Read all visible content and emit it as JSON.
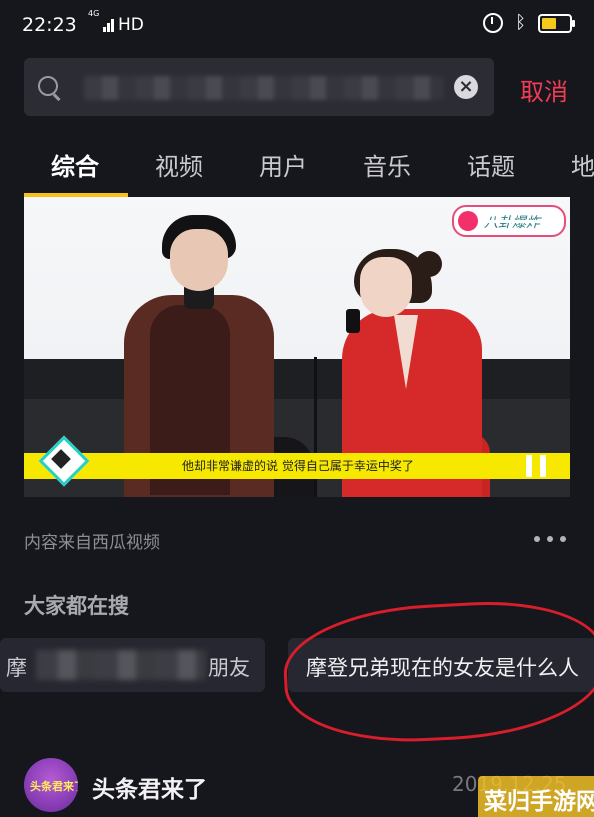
{
  "status_bar": {
    "time": "22:23",
    "network_small": "4G",
    "network": "HD"
  },
  "search": {
    "cancel_label": "取消"
  },
  "tabs": [
    {
      "label": "综合"
    },
    {
      "label": "视频"
    },
    {
      "label": "用户"
    },
    {
      "label": "音乐"
    },
    {
      "label": "话题"
    },
    {
      "label": "地"
    }
  ],
  "video": {
    "logo_text": "八卦爆炸",
    "caption": "他却非常谦虚的说 觉得自己属于幸运中奖了"
  },
  "source_text": "内容来自西瓜视频",
  "trending": {
    "title": "大家都在搜",
    "chips": [
      {
        "prefix": "摩",
        "suffix": "朋友"
      },
      {
        "label": "摩登兄弟现在的女友是什么人"
      }
    ]
  },
  "post": {
    "avatar_text": "头条君来了",
    "author": "头条君来了",
    "date": "2019.12.25"
  },
  "watermark": "菜归手游网",
  "colors": {
    "background": "#16171d",
    "accent_yellow": "#f7c21c",
    "cancel_red": "#f23b54",
    "annotation_red": "#d81e2a"
  }
}
